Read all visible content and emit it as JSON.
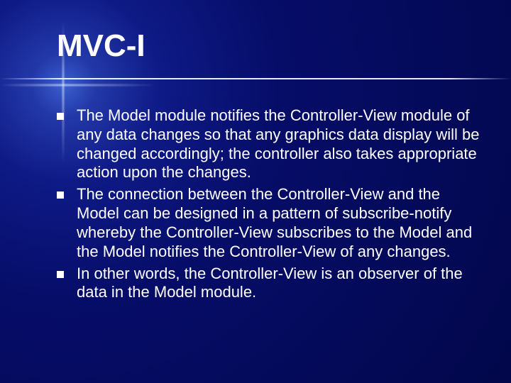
{
  "slide": {
    "title": "MVC-I",
    "bullets": [
      "The Model module notifies the Controller-View module of any data changes so that any graphics data display will be changed accordingly; the controller also takes appropriate action upon the changes.",
      "The connection between the Controller-View and the Model can be designed in a pattern of subscribe-notify whereby the Controller-View subscribes to the Model and the Model notifies the Controller-View of any changes.",
      "In other words, the Controller-View is an observer of the data in the Model module."
    ]
  }
}
